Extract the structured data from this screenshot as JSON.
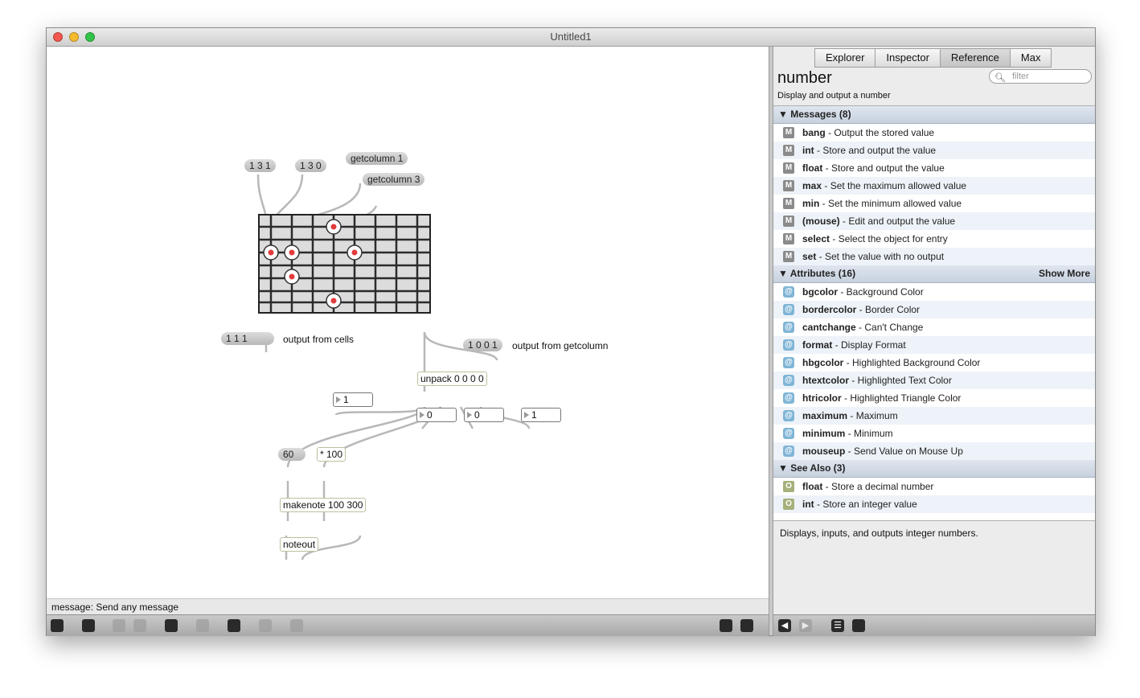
{
  "window": {
    "title": "Untitled1"
  },
  "patcher": {
    "messages": [
      "1 3 1",
      "1 3 0",
      "getcolumn 1",
      "getcolumn 3",
      "1 1 1",
      "1 0 0 1",
      "60"
    ],
    "objects": [
      "unpack 0 0 0 0",
      "* 100",
      "makenote 100 300",
      "noteout"
    ],
    "numbers": [
      "1",
      "0",
      "0",
      "1"
    ],
    "labels": {
      "cells": "output from cells",
      "getcolumn": "output from getcolumn"
    }
  },
  "status": {
    "text": "message: Send any message"
  },
  "sidebar": {
    "tabs": [
      "Explorer",
      "Inspector",
      "Reference",
      "Max"
    ],
    "filter_placeholder": "filter",
    "object_name": "number",
    "object_desc": "Display and output a number",
    "messages_header": "▼ Messages (8)",
    "messages": [
      {
        "name": "bang",
        "desc": " - Output the stored value"
      },
      {
        "name": "int",
        "desc": " - Store and output the value"
      },
      {
        "name": "float",
        "desc": " - Store and output the value"
      },
      {
        "name": "max",
        "desc": " - Set the maximum allowed value"
      },
      {
        "name": "min",
        "desc": " - Set the minimum allowed value"
      },
      {
        "name": "(mouse)",
        "desc": " - Edit and output the value"
      },
      {
        "name": "select",
        "desc": " - Select the object for entry"
      },
      {
        "name": "set",
        "desc": " - Set the value with no output"
      }
    ],
    "attributes_header": "▼ Attributes (16)",
    "show_more": "Show More",
    "attributes": [
      {
        "name": "bgcolor",
        "desc": " - Background Color"
      },
      {
        "name": "bordercolor",
        "desc": " - Border Color"
      },
      {
        "name": "cantchange",
        "desc": " - Can't Change"
      },
      {
        "name": "format",
        "desc": " - Display Format"
      },
      {
        "name": "hbgcolor",
        "desc": " - Highlighted Background Color"
      },
      {
        "name": "htextcolor",
        "desc": " - Highlighted Text Color"
      },
      {
        "name": "htricolor",
        "desc": " - Highlighted Triangle Color"
      },
      {
        "name": "maximum",
        "desc": " - Maximum"
      },
      {
        "name": "minimum",
        "desc": " - Minimum"
      },
      {
        "name": "mouseup",
        "desc": " - Send Value on Mouse Up"
      }
    ],
    "seealso_header": "▼ See Also (3)",
    "seealso": [
      {
        "name": "float",
        "desc": " - Store a decimal number"
      },
      {
        "name": "int",
        "desc": " - Store an integer value"
      }
    ],
    "description": "Displays, inputs, and outputs integer numbers."
  },
  "icons": {
    "message": "M",
    "attribute": "@",
    "object": "O"
  }
}
